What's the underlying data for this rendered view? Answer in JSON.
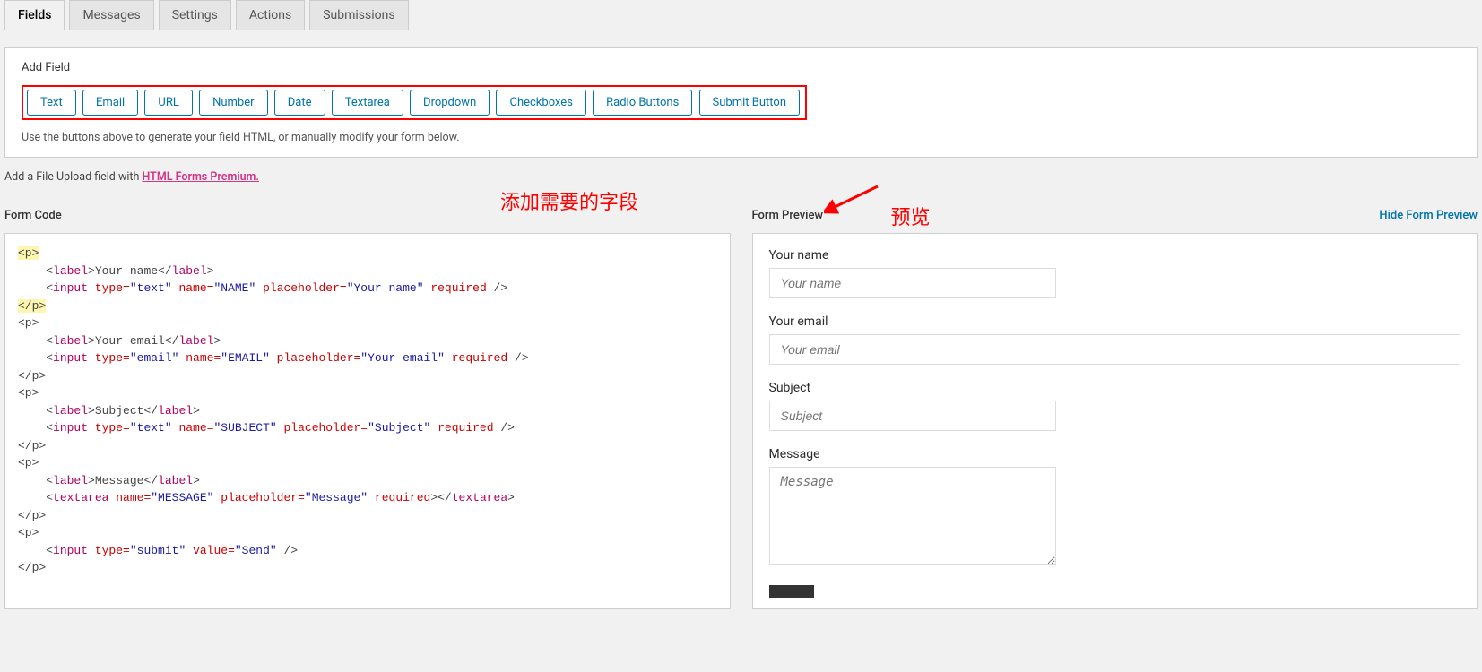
{
  "tabs": [
    "Fields",
    "Messages",
    "Settings",
    "Actions",
    "Submissions"
  ],
  "active_tab": "Fields",
  "add_field_title": "Add Field",
  "field_buttons": [
    "Text",
    "Email",
    "URL",
    "Number",
    "Date",
    "Textarea",
    "Dropdown",
    "Checkboxes",
    "Radio Buttons",
    "Submit Button"
  ],
  "help_text": "Use the buttons above to generate your field HTML, or manually modify your form below.",
  "upload_note_prefix": "Add a File Upload field with ",
  "upload_note_link": "HTML Forms Premium.",
  "form_code_title": "Form Code",
  "form_preview_title": "Form Preview",
  "hide_preview_label": "Hide Form Preview",
  "annotation_add_fields": "添加需要的字段",
  "annotation_preview": "预览",
  "preview_fields": {
    "name_label": "Your name",
    "name_ph": "Your name",
    "email_label": "Your email",
    "email_ph": "Your email",
    "subject_label": "Subject",
    "subject_ph": "Subject",
    "message_label": "Message",
    "message_ph": "Message"
  },
  "code": {
    "l1": "<p>",
    "l2a": "    <",
    "l2b": "label",
    "l2c": ">Your name</",
    "l2d": "label",
    "l2e": ">",
    "l3a": "    <",
    "l3b": "input",
    "l3c": " type=",
    "l3d": "\"text\"",
    "l3e": " name=",
    "l3f": "\"NAME\"",
    "l3g": " placeholder=",
    "l3h": "\"Your name\"",
    "l3i": " required",
    "l3j": " />",
    "l4": "</p>",
    "l5": "<p>",
    "l6a": "    <",
    "l6b": "label",
    "l6c": ">Your email</",
    "l6d": "label",
    "l6e": ">",
    "l7a": "    <",
    "l7b": "input",
    "l7c": " type=",
    "l7d": "\"email\"",
    "l7e": " name=",
    "l7f": "\"EMAIL\"",
    "l7g": " placeholder=",
    "l7h": "\"Your email\"",
    "l7i": " required",
    "l7j": " />",
    "l8": "</p>",
    "l9": "<p>",
    "l10a": "    <",
    "l10b": "label",
    "l10c": ">Subject</",
    "l10d": "label",
    "l10e": ">",
    "l11a": "    <",
    "l11b": "input",
    "l11c": " type=",
    "l11d": "\"text\"",
    "l11e": " name=",
    "l11f": "\"SUBJECT\"",
    "l11g": " placeholder=",
    "l11h": "\"Subject\"",
    "l11i": " required",
    "l11j": " />",
    "l12": "</p>",
    "l13": "<p>",
    "l14a": "    <",
    "l14b": "label",
    "l14c": ">Message</",
    "l14d": "label",
    "l14e": ">",
    "l15a": "    <",
    "l15b": "textarea",
    "l15c": " name=",
    "l15d": "\"MESSAGE\"",
    "l15e": " placeholder=",
    "l15f": "\"Message\"",
    "l15g": " required",
    "l15h": "></",
    "l15i": "textarea",
    "l15j": ">",
    "l16": "</p>",
    "l17": "<p>",
    "l18a": "    <",
    "l18b": "input",
    "l18c": " type=",
    "l18d": "\"submit\"",
    "l18e": " value=",
    "l18f": "\"Send\"",
    "l18g": " />",
    "l19": "</p>"
  }
}
